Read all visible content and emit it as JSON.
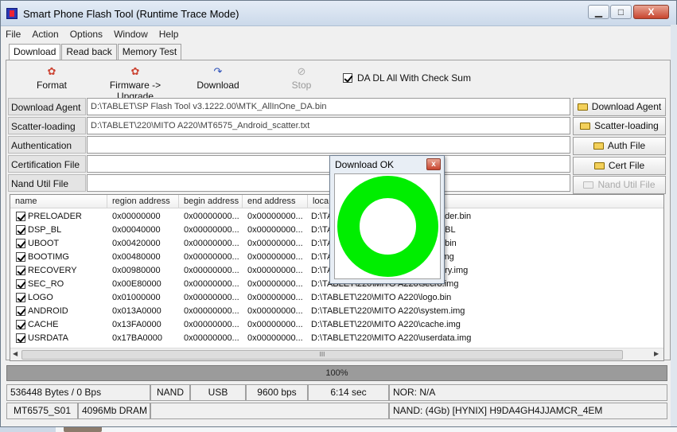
{
  "window": {
    "title": "Smart Phone Flash Tool (Runtime Trace Mode)",
    "min_glyph": "▁",
    "max_glyph": "□",
    "close_glyph": "X"
  },
  "menu": [
    "File",
    "Action",
    "Options",
    "Window",
    "Help"
  ],
  "tabs": [
    "Download",
    "Read back",
    "Memory Test"
  ],
  "toolbar": {
    "format": "Format",
    "upgrade": "Firmware -> Upgrade",
    "download": "Download",
    "stop": "Stop",
    "checksum_label": "DA DL All With Check Sum",
    "checksum_checked": true
  },
  "fields": {
    "download_agent": {
      "label": "Download Agent",
      "value": "D:\\TABLET\\SP Flash Tool v3.1222.00\\MTK_AllInOne_DA.bin",
      "button": "Download Agent"
    },
    "scatter": {
      "label": "Scatter-loading File",
      "value": "D:\\TABLET\\220\\MITO A220\\MT6575_Android_scatter.txt",
      "button": "Scatter-loading"
    },
    "auth": {
      "label": "Authentication File",
      "value": "",
      "button": "Auth File"
    },
    "cert": {
      "label": "Certification File",
      "value": "",
      "button": "Cert File"
    },
    "nand": {
      "label": "Nand Util File",
      "value": "",
      "button": "Nand Util File"
    }
  },
  "table": {
    "columns": [
      "name",
      "region address",
      "begin address",
      "end address",
      "loca"
    ],
    "rows": [
      {
        "name": "PRELOADER",
        "region": "0x00000000",
        "begin": "0x00000000...",
        "end": "0x00000000...",
        "loc": "D:\\TA",
        "loc_tail": "ader.bin"
      },
      {
        "name": "DSP_BL",
        "region": "0x00040000",
        "begin": "0x00000000...",
        "end": "0x00000000...",
        "loc": "D:\\TA",
        "loc_tail": "_BL"
      },
      {
        "name": "UBOOT",
        "region": "0x00420000",
        "begin": "0x00000000...",
        "end": "0x00000000...",
        "loc": "D:\\TA",
        "loc_tail": "t.bin"
      },
      {
        "name": "BOOTIMG",
        "region": "0x00480000",
        "begin": "0x00000000...",
        "end": "0x00000000...",
        "loc": "D:\\TA",
        "loc_tail": "img"
      },
      {
        "name": "RECOVERY",
        "region": "0x00980000",
        "begin": "0x00000000...",
        "end": "0x00000000...",
        "loc": "D:\\TA",
        "loc_tail": "ery.img"
      },
      {
        "name": "SEC_RO",
        "region": "0x00E80000",
        "begin": "0x00000000...",
        "end": "0x00000000...",
        "loc": "D:\\TABLET\\220\\MITO A220\\secro.img",
        "loc_tail": ""
      },
      {
        "name": "LOGO",
        "region": "0x01000000",
        "begin": "0x00000000...",
        "end": "0x00000000...",
        "loc": "D:\\TABLET\\220\\MITO A220\\logo.bin",
        "loc_tail": ""
      },
      {
        "name": "ANDROID",
        "region": "0x013A0000",
        "begin": "0x00000000...",
        "end": "0x00000000...",
        "loc": "D:\\TABLET\\220\\MITO A220\\system.img",
        "loc_tail": ""
      },
      {
        "name": "CACHE",
        "region": "0x13FA0000",
        "begin": "0x00000000...",
        "end": "0x00000000...",
        "loc": "D:\\TABLET\\220\\MITO A220\\cache.img",
        "loc_tail": ""
      },
      {
        "name": "USRDATA",
        "region": "0x17BA0000",
        "begin": "0x00000000...",
        "end": "0x00000000...",
        "loc": "D:\\TABLET\\220\\MITO A220\\userdata.img",
        "loc_tail": ""
      }
    ],
    "scroll_grip": "III"
  },
  "progress": {
    "label": "100%",
    "fraction": 1.0
  },
  "status": {
    "bytes": "536448 Bytes / 0 Bps",
    "storage": "NAND",
    "port": "USB",
    "baud": "9600 bps",
    "time": "6:14 sec",
    "nor": "NOR: N/A",
    "chip": "MT6575_S01",
    "dram": "4096Mb DRAM",
    "nand": "NAND: (4Gb) [HYNIX] H9DA4GH4JJAMCR_4EM"
  },
  "dialog": {
    "title": "Download OK",
    "close_glyph": "x",
    "ring_color": "#00ee00"
  },
  "icons": {
    "format": "format-icon",
    "upgrade": "firmware-upgrade-icon",
    "download": "download-arrow-icon",
    "stop": "stop-icon",
    "folder": "folder-icon"
  }
}
